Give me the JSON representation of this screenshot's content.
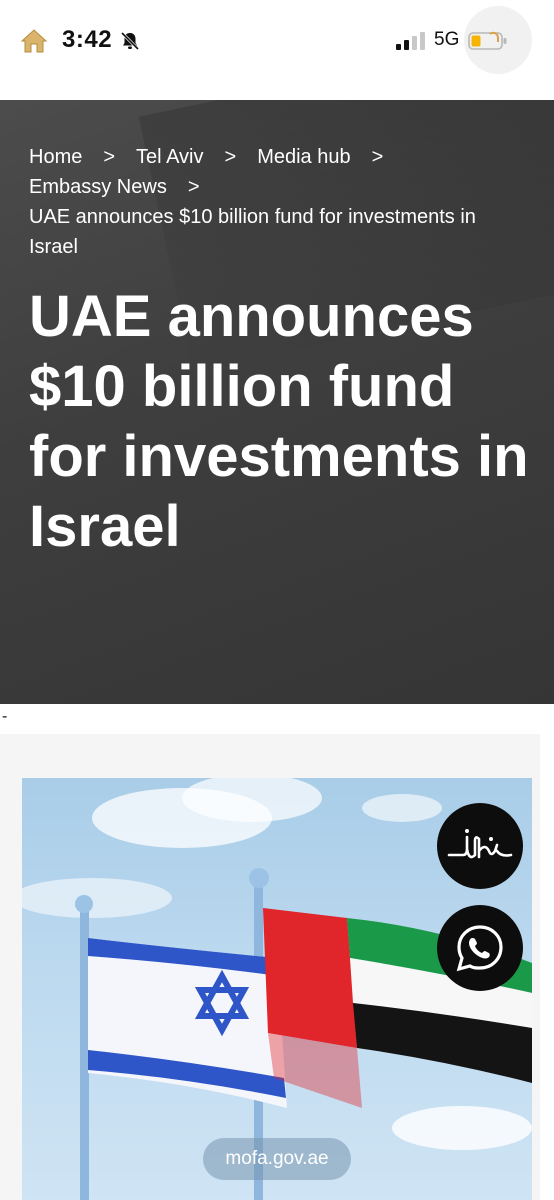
{
  "status_bar": {
    "time": "3:42",
    "network": "5G"
  },
  "breadcrumb": {
    "items": [
      "Home",
      "Tel Aviv",
      "Media hub",
      "Embassy News"
    ],
    "separator": ">",
    "current": "UAE announces $10 billion fund for investments in Israel"
  },
  "article": {
    "title": "UAE announces $10 billion fund for investments in Israel",
    "separator_text": "-"
  },
  "floating_buttons": {
    "logo_icon": "calligraphy-logo-icon",
    "whatsapp_icon": "whatsapp-icon"
  },
  "browser": {
    "url": "mofa.gov.ae"
  },
  "colors": {
    "hero_bg": "#3e3e3e",
    "uae_red": "#e0252b",
    "uae_green": "#1a9a48",
    "israel_blue": "#2f56c8"
  }
}
